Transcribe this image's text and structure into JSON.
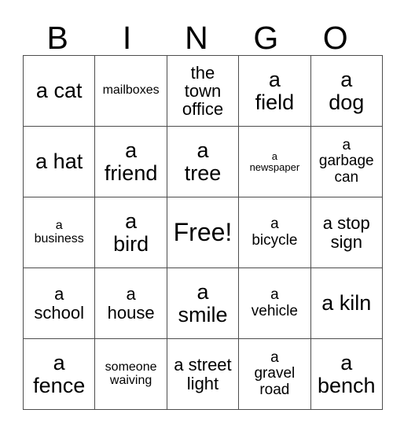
{
  "card": {
    "header_letters": [
      "B",
      "I",
      "N",
      "G",
      "O"
    ],
    "columns": 5,
    "rows": 5,
    "free_space_label": "Free!",
    "free_space_position": {
      "row": 3,
      "column": 3
    },
    "border_color": "#4d4d4d",
    "background_color": "#ffffff",
    "text_color": "#000000",
    "grid": [
      [
        {
          "text": "a cat",
          "size": "lg"
        },
        {
          "text": "mailboxes",
          "size": "xs"
        },
        {
          "text": "the\ntown\noffice",
          "size": "md"
        },
        {
          "text": "a\nfield",
          "size": "lg"
        },
        {
          "text": "a\ndog",
          "size": "lg"
        }
      ],
      [
        {
          "text": "a hat",
          "size": "lg"
        },
        {
          "text": "a\nfriend",
          "size": "lg"
        },
        {
          "text": "a\ntree",
          "size": "lg"
        },
        {
          "text": "a\nnewspaper",
          "size": "xxs"
        },
        {
          "text": "a\ngarbage\ncan",
          "size": "sm"
        }
      ],
      [
        {
          "text": "a\nbusiness",
          "size": "xs"
        },
        {
          "text": "a\nbird",
          "size": "lg"
        },
        {
          "text": "Free!",
          "size": "xl",
          "free": true
        },
        {
          "text": "a\nbicycle",
          "size": "sm"
        },
        {
          "text": "a stop\nsign",
          "size": "md"
        }
      ],
      [
        {
          "text": "a\nschool",
          "size": "md"
        },
        {
          "text": "a\nhouse",
          "size": "md"
        },
        {
          "text": "a\nsmile",
          "size": "lg"
        },
        {
          "text": "a\nvehicle",
          "size": "sm"
        },
        {
          "text": "a kiln",
          "size": "lg"
        }
      ],
      [
        {
          "text": "a\nfence",
          "size": "lg"
        },
        {
          "text": "someone\nwaiving",
          "size": "xs"
        },
        {
          "text": "a street\nlight",
          "size": "md"
        },
        {
          "text": "a\ngravel\nroad",
          "size": "sm"
        },
        {
          "text": "a\nbench",
          "size": "lg"
        }
      ]
    ]
  }
}
